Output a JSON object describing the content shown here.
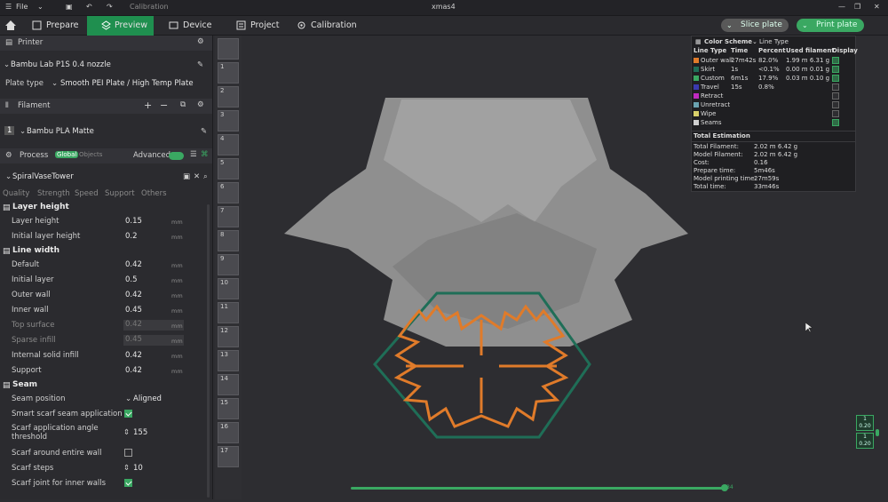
{
  "titlebar": {
    "menu_label": "File",
    "app_title": "Calibration",
    "doc_title": "xmas4"
  },
  "nav": {
    "tabs": [
      {
        "label": "Prepare"
      },
      {
        "label": "Preview"
      },
      {
        "label": "Device"
      },
      {
        "label": "Project"
      },
      {
        "label": "Calibration"
      }
    ],
    "slice_label": "Slice plate",
    "print_label": "Print plate"
  },
  "printer": {
    "section": "Printer",
    "name": "Bambu Lab P1S 0.4 nozzle",
    "plate_label": "Plate type",
    "plate_value": "Smooth PEI Plate / High Temp Plate"
  },
  "filament": {
    "section": "Filament",
    "index": "1",
    "name": "Bambu PLA Matte"
  },
  "process": {
    "section": "Process",
    "global": "Global",
    "objects": "Objects",
    "advanced": "Advanced",
    "preset": "SpiralVaseTower",
    "subtabs": [
      "Quality",
      "Strength",
      "Speed",
      "Support",
      "Others"
    ]
  },
  "settings": {
    "layer_height_title": "Layer height",
    "layer_height": {
      "label": "Layer height",
      "value": "0.15",
      "unit": "mm"
    },
    "initial_layer_height": {
      "label": "Initial layer height",
      "value": "0.2",
      "unit": "mm"
    },
    "line_width_title": "Line width",
    "lw": [
      {
        "label": "Default",
        "value": "0.42",
        "unit": "mm"
      },
      {
        "label": "Initial layer",
        "value": "0.5",
        "unit": "mm"
      },
      {
        "label": "Outer wall",
        "value": "0.42",
        "unit": "mm"
      },
      {
        "label": "Inner wall",
        "value": "0.45",
        "unit": "mm"
      },
      {
        "label": "Top surface",
        "value": "0.42",
        "unit": "mm"
      },
      {
        "label": "Sparse infill",
        "value": "0.45",
        "unit": "mm"
      },
      {
        "label": "Internal solid infill",
        "value": "0.42",
        "unit": "mm"
      },
      {
        "label": "Support",
        "value": "0.42",
        "unit": "mm"
      }
    ],
    "seam_title": "Seam",
    "seam_position": {
      "label": "Seam position",
      "value": "Aligned"
    },
    "smart_scarf": {
      "label": "Smart scarf seam application"
    },
    "scarf_angle": {
      "label": "Scarf application angle threshold",
      "value": "155"
    },
    "scarf_around": {
      "label": "Scarf around entire wall"
    },
    "scarf_steps": {
      "label": "Scarf steps",
      "value": "10"
    },
    "scarf_inner": {
      "label": "Scarf joint for inner walls"
    }
  },
  "layers": {
    "numbers": [
      "1",
      "2",
      "3",
      "4",
      "5",
      "6",
      "7",
      "8",
      "9",
      "10",
      "11",
      "12",
      "13",
      "14",
      "15",
      "16",
      "17"
    ],
    "slider_top": "1",
    "slider_top2": "0.20",
    "slider_bottom": "1",
    "slider_bottom2": "0.20",
    "progress_value": "84"
  },
  "legend": {
    "scheme_label": "Color Scheme",
    "scheme_value": "Line Type",
    "headers": [
      "Line Type",
      "Time",
      "Percent",
      "Used filament",
      "Display"
    ],
    "rows": [
      {
        "name": "Outer wall",
        "time": "27m42s",
        "percent": "82.0%",
        "used": "1.99 m  6.31 g",
        "color": "#e07b2a",
        "on": true
      },
      {
        "name": "Skirt",
        "time": "1s",
        "percent": "<0.1%",
        "used": "0.00 m  0.01 g",
        "color": "#1f6e57",
        "on": true
      },
      {
        "name": "Custom",
        "time": "6m1s",
        "percent": "17.9%",
        "used": "0.03 m  0.10 g",
        "color": "#3aa862",
        "on": true
      },
      {
        "name": "Travel",
        "time": "15s",
        "percent": "0.8%",
        "used": "",
        "color": "#3b3ab0",
        "on": false
      },
      {
        "name": "Retract",
        "time": "",
        "percent": "",
        "used": "",
        "color": "#c02ac0",
        "on": false
      },
      {
        "name": "Unretract",
        "time": "",
        "percent": "",
        "used": "",
        "color": "#6aa3b0",
        "on": false
      },
      {
        "name": "Wipe",
        "time": "",
        "percent": "",
        "used": "",
        "color": "#d8d06a",
        "on": false
      },
      {
        "name": "Seams",
        "time": "",
        "percent": "",
        "used": "",
        "color": "#cfcfcf",
        "on": true
      }
    ],
    "total_title": "Total Estimation",
    "totals": [
      {
        "label": "Total Filament:",
        "value": "2.02 m    6.42 g"
      },
      {
        "label": "Model Filament:",
        "value": "2.02 m    6.42 g"
      },
      {
        "label": "Cost:",
        "value": "0.16"
      },
      {
        "label": "Prepare time:",
        "value": "5m46s"
      },
      {
        "label": "Model printing time:",
        "value": "27m59s"
      },
      {
        "label": "Total time:",
        "value": "33m46s"
      }
    ]
  },
  "colors": {
    "accent": "#3aa862",
    "outer_wall": "#e07b2a",
    "skirt": "#1f6e57"
  }
}
